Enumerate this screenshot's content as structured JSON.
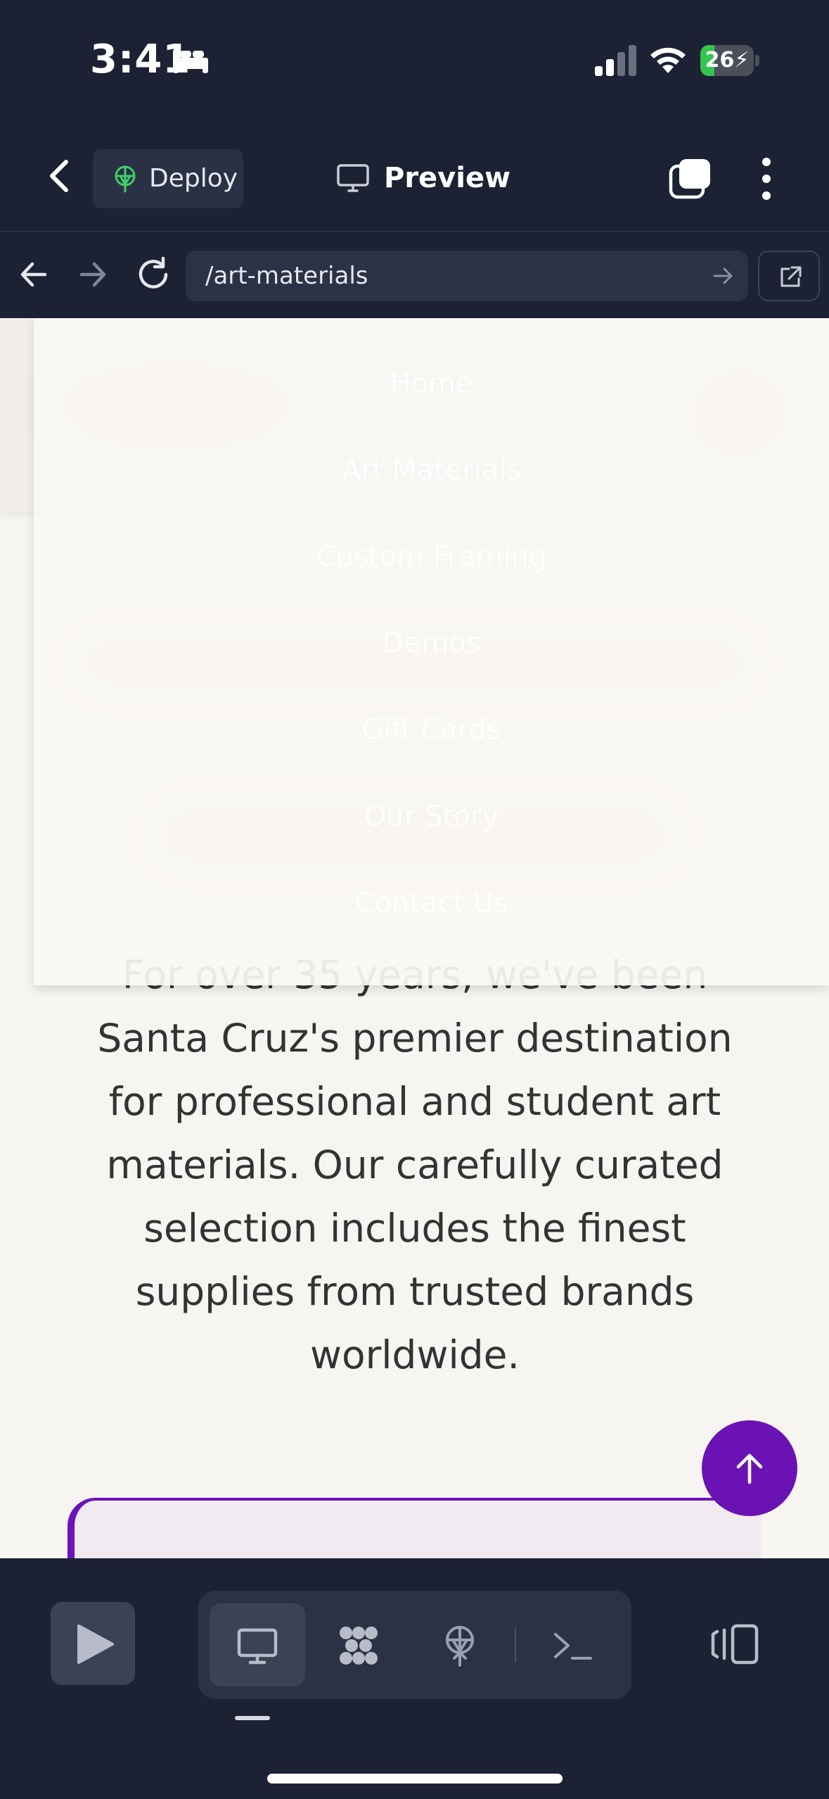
{
  "status_bar": {
    "time": "3:41",
    "battery_level": "26",
    "battery_percent": 26,
    "battery_color": "#36c450"
  },
  "header": {
    "deploy_label": "Deploy",
    "preview_label": "Preview",
    "icons": [
      "back-chevron-icon",
      "deploy-icon",
      "monitor-icon",
      "tabs-icon",
      "more-vertical-icon"
    ]
  },
  "browser": {
    "url": "/art-materials"
  },
  "menu": {
    "items": [
      {
        "label": "Home"
      },
      {
        "label": "Art Materials"
      },
      {
        "label": "Custom Framing"
      },
      {
        "label": "Demos"
      },
      {
        "label": "Gift Cards"
      },
      {
        "label": "Our Story"
      },
      {
        "label": "Contact Us"
      }
    ]
  },
  "content": {
    "body_lines": [
      "For over 35 years, we've been",
      "Santa Cruz's premier destination",
      "for professional and student art",
      "materials. Our carefully curated",
      "selection includes the finest",
      "supplies from trusted brands",
      "worldwide."
    ],
    "accent_color": "#6b12b5"
  },
  "toolbar": {
    "icons": [
      "play-icon",
      "desktop-icon",
      "packages-icon",
      "deploy-icon",
      "terminal-icon",
      "panel-toggle-icon"
    ]
  }
}
